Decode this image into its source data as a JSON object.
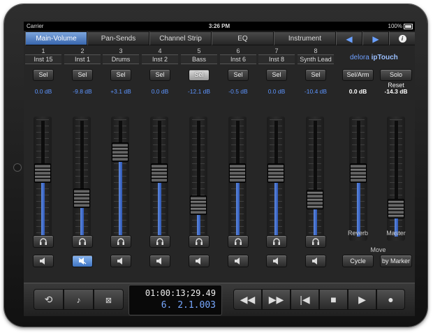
{
  "status_bar": {
    "carrier": "Carrier",
    "time": "3:26 PM",
    "battery": "100%"
  },
  "tabs": [
    {
      "label": "Main-Volume",
      "active": true
    },
    {
      "label": "Pan-Sends",
      "active": false
    },
    {
      "label": "Channel Strip",
      "active": false
    },
    {
      "label": "EQ",
      "active": false
    },
    {
      "label": "Instrument",
      "active": false
    }
  ],
  "nav": {
    "prev_glyph": "◀",
    "next_glyph": "▶",
    "info_glyph": "i"
  },
  "channels": [
    {
      "number": "1",
      "name": "Inst 15",
      "sel_label": "Sel",
      "db": "0.0 dB",
      "level": 0.55,
      "sel_lit": false,
      "mute_on": false
    },
    {
      "number": "2",
      "name": "Inst 1",
      "sel_label": "Sel",
      "db": "-9.8 dB",
      "level": 0.33,
      "sel_lit": false,
      "mute_on": true
    },
    {
      "number": "3",
      "name": "Drums",
      "sel_label": "Sel",
      "db": "+3.1 dB",
      "level": 0.73,
      "sel_lit": false,
      "mute_on": false
    },
    {
      "number": "4",
      "name": "Inst 2",
      "sel_label": "Sel",
      "db": "0.0 dB",
      "level": 0.55,
      "sel_lit": false,
      "mute_on": false
    },
    {
      "number": "5",
      "name": "Bass",
      "sel_label": "Sel",
      "db": "-12.1 dB",
      "level": 0.27,
      "sel_lit": true,
      "mute_on": false
    },
    {
      "number": "6",
      "name": "Inst 6",
      "sel_label": "Sel",
      "db": "-0.5 dB",
      "level": 0.55,
      "sel_lit": false,
      "mute_on": false
    },
    {
      "number": "7",
      "name": "Inst 8",
      "sel_label": "Sel",
      "db": "0.0 dB",
      "level": 0.55,
      "sel_lit": false,
      "mute_on": false
    },
    {
      "number": "8",
      "name": "Synth Lead",
      "sel_label": "Sel",
      "db": "-10.4 dB",
      "level": 0.32,
      "sel_lit": false,
      "mute_on": false
    }
  ],
  "logo": {
    "brand": "delora",
    "product": "ipTouch"
  },
  "right_panel": {
    "sel_arm_label": "Sel/Arm",
    "solo_reset_label": "Solo Reset",
    "reverb": {
      "db": "0.0 dB",
      "label": "Reverb",
      "level": 0.55
    },
    "master": {
      "db": "-14.3 dB",
      "label": "Master",
      "level": 0.24
    },
    "move_label": "Move",
    "cycle_label": "Cycle",
    "by_marker_label": "by Marker"
  },
  "icons": {
    "headphones": "headphones-icon",
    "speaker": "speaker-icon"
  },
  "transport": {
    "timecode": "01:00:13;29.49",
    "bars": "6. 2.1.003",
    "buttons": [
      "rewind",
      "fast-forward",
      "go-to-start",
      "stop",
      "play",
      "record"
    ]
  }
}
